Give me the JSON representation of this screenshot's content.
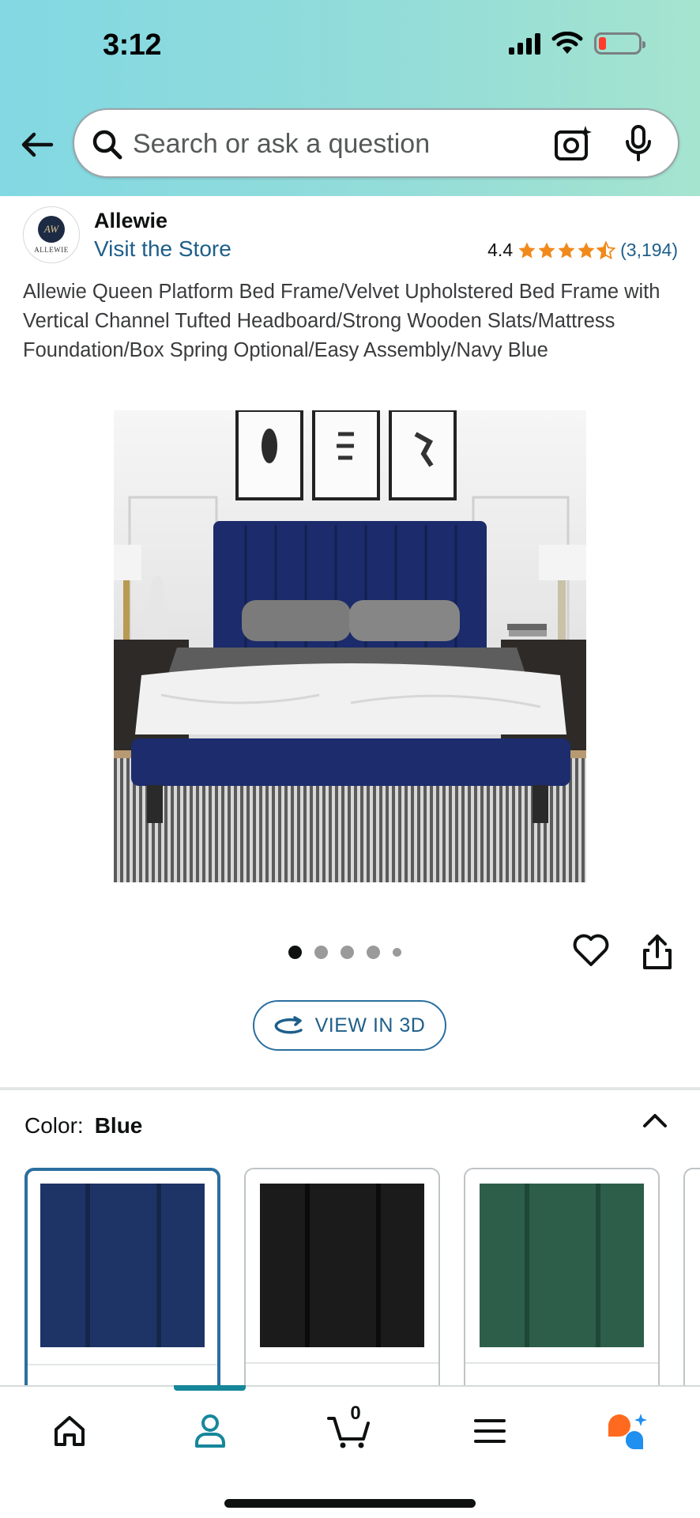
{
  "status_bar": {
    "time": "3:12",
    "battery_color": "#ff3b30"
  },
  "search": {
    "placeholder": "Search or ask a question",
    "value": ""
  },
  "store": {
    "logo_text": "ALLEWIE",
    "logo_monogram": "AW",
    "name": "Allewie",
    "visit_link": "Visit the Store"
  },
  "rating": {
    "value": "4.4",
    "stars": 4.4,
    "count": "(3,194)",
    "star_color": "#f08a1c"
  },
  "product": {
    "title": "Allewie Queen Platform Bed Frame/Velvet Upholstered Bed Frame with Vertical Channel Tufted Headboard/Strong Wooden Slats/Mattress Foundation/Box Spring Optional/Easy Assembly/Navy Blue",
    "image_alt": "Navy blue velvet platform bed with tufted headboard in a bedroom",
    "image_count": 5,
    "active_image": 1
  },
  "actions": {
    "view_3d_label": "VIEW IN 3D"
  },
  "color_selector": {
    "label": "Color:",
    "selected": "Blue",
    "options": [
      {
        "name": "Blue",
        "color": "#1f3466",
        "selected": true
      },
      {
        "name": "Black",
        "color": "#1b1b1b",
        "selected": false
      },
      {
        "name": "Green",
        "color": "#2d5e4a",
        "selected": false
      }
    ]
  },
  "bottom_nav": {
    "items": [
      "home-icon",
      "account-icon",
      "cart-icon",
      "menu-icon",
      "rufus-icon"
    ],
    "cart_count": "0",
    "active": "account-icon",
    "accent_color": "#16879b"
  }
}
